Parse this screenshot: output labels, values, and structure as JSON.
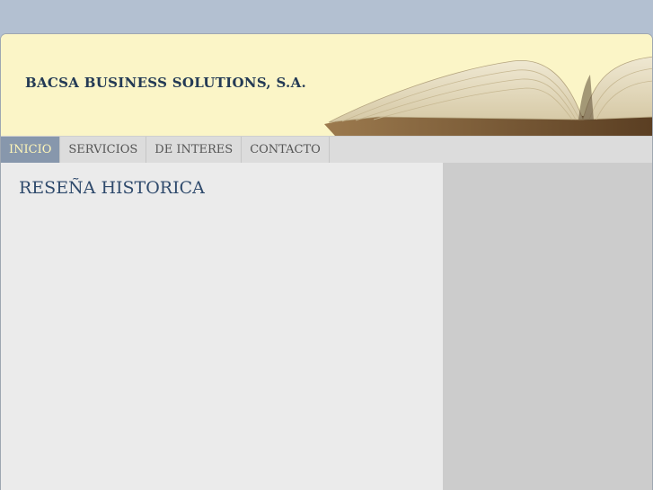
{
  "header": {
    "title": "BACSA BUSINESS SOLUTIONS, S.A.",
    "image": "open-book-image"
  },
  "nav": {
    "items": [
      {
        "label": "INICIO",
        "active": true
      },
      {
        "label": "SERVICIOS",
        "active": false
      },
      {
        "label": "DE INTERES",
        "active": false
      },
      {
        "label": "CONTACTO",
        "active": false
      }
    ]
  },
  "main": {
    "heading": "RESEÑA HISTORICA"
  },
  "colors": {
    "background": "#b3c0d1",
    "header": "#fbf5c7",
    "title": "#243a55",
    "nav_active": "#8797ac",
    "nav_active_text": "#fff6b8",
    "sidebar": "#cccccc"
  }
}
